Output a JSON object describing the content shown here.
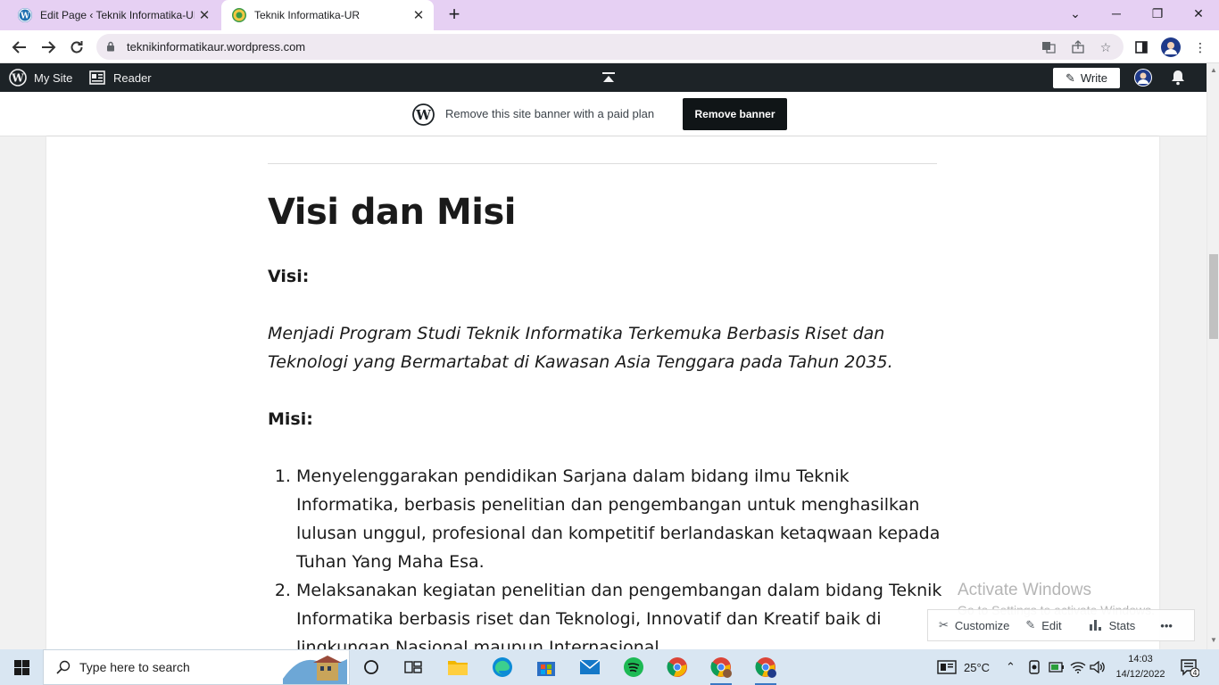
{
  "browser": {
    "tabs": [
      {
        "title": "Edit Page ‹ Teknik Informatika-UR",
        "active": false
      },
      {
        "title": "Teknik Informatika-UR",
        "active": true
      }
    ],
    "url": "teknikinformatikaur.wordpress.com"
  },
  "adminbar": {
    "my_site": "My Site",
    "reader": "Reader",
    "write": "Write"
  },
  "banner": {
    "text": "Remove this site banner with a paid plan",
    "button": "Remove banner"
  },
  "page": {
    "title": "Visi dan Misi",
    "visi_heading": "Visi:",
    "visi_text": "Menjadi Program Studi Teknik Informatika Terkemuka Berbasis Riset dan Teknologi yang Bermartabat di Kawasan Asia Tenggara pada Tahun 2035.",
    "misi_heading": "Misi:",
    "misi_items": [
      "Menyelenggarakan pendidikan Sarjana dalam bidang ilmu Teknik Informatika, berbasis penelitian dan pengembangan untuk menghasilkan lulusan unggul, profesional dan kompetitif berlandaskan ketaqwaan kepada Tuhan Yang Maha Esa.",
      "Melaksanakan kegiatan penelitian dan pengembangan dalam bidang Teknik Informatika berbasis riset  dan Teknologi, Innovatif dan Kreatif baik di lingkungan Nasional maupun Internasional."
    ]
  },
  "watermark": {
    "title": "Activate Windows",
    "subtitle": "Go to Settings to activate Windows."
  },
  "customize_bar": {
    "customize": "Customize",
    "edit": "Edit",
    "stats": "Stats",
    "more": "•••"
  },
  "taskbar": {
    "search_placeholder": "Type here to search",
    "temperature": "25°C",
    "time": "14:03",
    "date": "14/12/2022",
    "notifications": "4"
  },
  "colors": {
    "tabstrip": "#e6d0f3",
    "adminbar": "#1d2327",
    "taskbar": "#d9e6f2"
  }
}
